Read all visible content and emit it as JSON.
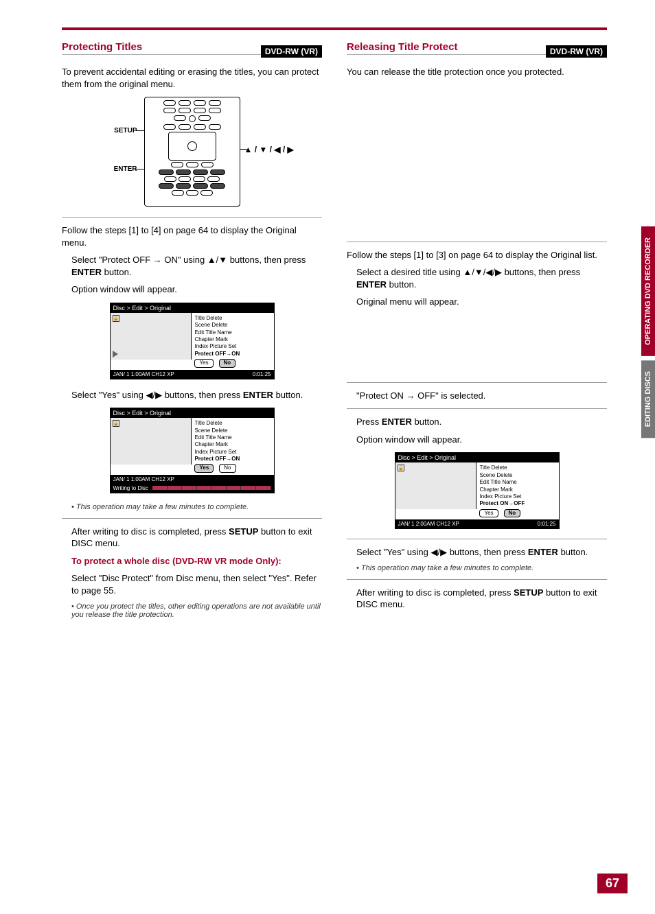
{
  "page": {
    "number": "67"
  },
  "side_tabs": {
    "active": "OPERATING DVD RECORDER",
    "inactive": "EDITING DISCS"
  },
  "left": {
    "section_title": "Protecting Titles",
    "mode_badge": "DVD-RW (VR)",
    "intro": "To prevent accidental editing or erasing the titles, you can protect them from the original menu.",
    "diagram_labels": {
      "setup": "SETUP",
      "enter": "ENTER",
      "arrows": "▲ / ▼ / ◀ / ▶"
    },
    "follow_steps": "Follow the steps [1] to [4] on page 64 to display the Original menu.",
    "step5_line1_a": "Select \"Protect OFF → ON\" using ",
    "step5_line1_b": "▲/▼",
    "step5_line1_c": " buttons, then press ",
    "step5_line1_enter": "ENTER",
    "step5_line1_d": " button.",
    "step5_line2": "Option window will appear.",
    "osd1": {
      "breadcrumb": "Disc > Edit > Original",
      "menu_items": [
        "Title Delete",
        "Scene Delete",
        "Edit Title Name",
        "Chapter Mark",
        "Index Picture Set",
        "Protect OFF→ON"
      ],
      "yes": "Yes",
      "no": "No",
      "foot_left": "JAN/ 1   1:00AM  CH12     XP",
      "foot_right": "0:01:25"
    },
    "step6_a": "Select \"Yes\" using ",
    "step6_arrows": "◀/▶",
    "step6_b": " buttons, then press ",
    "step6_enter": "ENTER",
    "step6_c": " button.",
    "osd2": {
      "breadcrumb": "Disc > Edit > Original",
      "menu_items": [
        "Title Delete",
        "Scene Delete",
        "Edit Title Name",
        "Chapter Mark",
        "Index Picture Set",
        "Protect OFF→ON"
      ],
      "yes": "Yes",
      "no": "No",
      "foot_left": "JAN/ 1   1:00AM  CH12     XP",
      "writing": "Writing to Disc"
    },
    "note1": "This operation may take a few minutes to complete.",
    "step7_a": "After writing to disc is completed, press ",
    "step7_setup": "SETUP",
    "step7_b": " button to exit DISC menu.",
    "whole_disc_heading": "To protect a whole disc (DVD-RW VR mode Only):",
    "whole_disc_body": "Select \"Disc Protect\" from Disc menu, then select \"Yes\". Refer to page 55.",
    "note2": "Once you protect the titles, other editing operations are not available until you release the title protection."
  },
  "right": {
    "section_title": "Releasing Title Protect",
    "mode_badge": "DVD-RW (VR)",
    "intro": "You can release the title protection once you protected.",
    "follow_steps": "Follow the steps [1] to [3] on page 64 to display the Original list.",
    "step4_a": "Select a desired title using ",
    "step4_arrows": "▲/▼/◀/▶",
    "step4_b": " buttons, then press ",
    "step4_enter": "ENTER",
    "step4_c": " button.",
    "step4_line2": "Original menu will appear.",
    "step5": "\"Protect ON → OFF\" is selected.",
    "step6_a": "Press ",
    "step6_enter": "ENTER",
    "step6_b": " button.",
    "step6_line2": "Option window will appear.",
    "osd": {
      "breadcrumb": "Disc > Edit > Original",
      "menu_items": [
        "Title Delete",
        "Scene Delete",
        "Edit Title Name",
        "Chapter Mark",
        "Index Picture Set",
        "Protect ON→OFF"
      ],
      "yes": "Yes",
      "no": "No",
      "foot_left": "JAN/ 1   2:00AM  CH12     XP",
      "foot_right": "0:01:25"
    },
    "step7_a": "Select \"Yes\" using ",
    "step7_arrows": "◀/▶",
    "step7_b": " buttons, then press ",
    "step7_enter": "ENTER",
    "step7_c": " button.",
    "note1": "This operation may take a few minutes to complete.",
    "step8_a": "After writing to disc is completed, press ",
    "step8_setup": "SETUP",
    "step8_b": " button to exit DISC menu."
  }
}
